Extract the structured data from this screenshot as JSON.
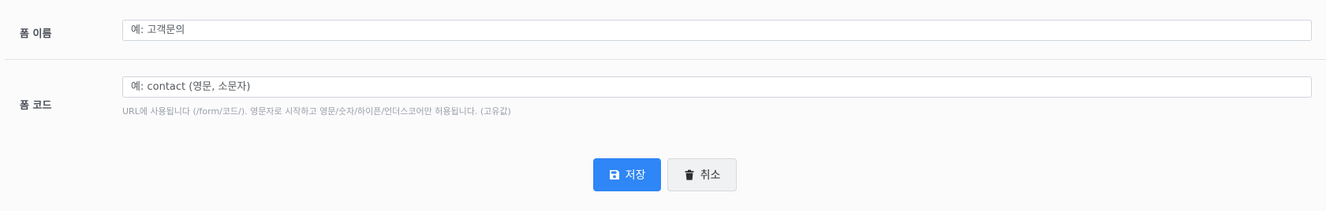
{
  "form": {
    "name_field": {
      "label": "폼 이름",
      "placeholder": "예: 고객문의",
      "value": ""
    },
    "code_field": {
      "label": "폼 코드",
      "placeholder": "예: contact (영문, 소문자)",
      "value": "",
      "help": "URL에 사용됩니다 (/form/코드/). 영문자로 시작하고 영문/숫자/하이픈/언더스코어만 허용됩니다. (고유값)"
    }
  },
  "actions": {
    "save_label": "저장",
    "save_icon": "floppy-disk-icon",
    "cancel_label": "취소",
    "cancel_icon": "trash-icon",
    "accent_color": "#2f86f6"
  }
}
